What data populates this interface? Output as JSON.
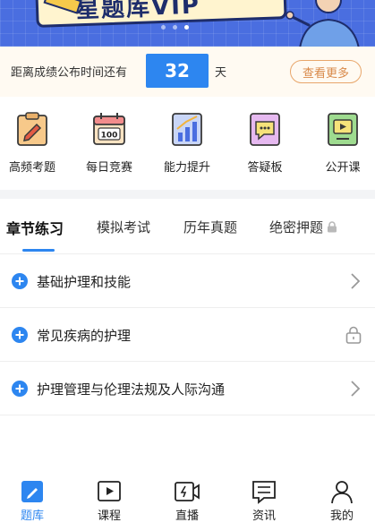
{
  "banner": {
    "title": "星题库VIP"
  },
  "countdown": {
    "label": "距离成绩公布时间还有",
    "days": "32",
    "unit": "天",
    "more_label": "查看更多"
  },
  "features": [
    {
      "label": "高频考题",
      "icon": "clipboard-pen-icon"
    },
    {
      "label": "每日竞赛",
      "icon": "calendar-100-icon"
    },
    {
      "label": "能力提升",
      "icon": "bar-chart-icon"
    },
    {
      "label": "答疑板",
      "icon": "chat-bubble-icon"
    },
    {
      "label": "公开课",
      "icon": "video-play-icon"
    }
  ],
  "tabs": [
    {
      "label": "章节练习",
      "active": true
    },
    {
      "label": "模拟考试"
    },
    {
      "label": "历年真题"
    },
    {
      "label": "绝密押题",
      "locked": true
    }
  ],
  "chapters": [
    {
      "label": "基础护理和技能",
      "trail": "chevron-right-icon"
    },
    {
      "label": "常见疾病的护理",
      "trail": "lock-icon"
    },
    {
      "label": "护理管理与伦理法规及人际沟通",
      "trail": "chevron-right-icon"
    }
  ],
  "bottom_nav": [
    {
      "label": "题库",
      "icon": "question-bank-icon",
      "active": true
    },
    {
      "label": "课程",
      "icon": "course-play-icon"
    },
    {
      "label": "直播",
      "icon": "live-icon"
    },
    {
      "label": "资讯",
      "icon": "news-icon"
    },
    {
      "label": "我的",
      "icon": "user-icon"
    }
  ],
  "colors": {
    "accent": "#2d86f0",
    "banner": "#4a6ee0",
    "more_border": "#e8a66b"
  }
}
